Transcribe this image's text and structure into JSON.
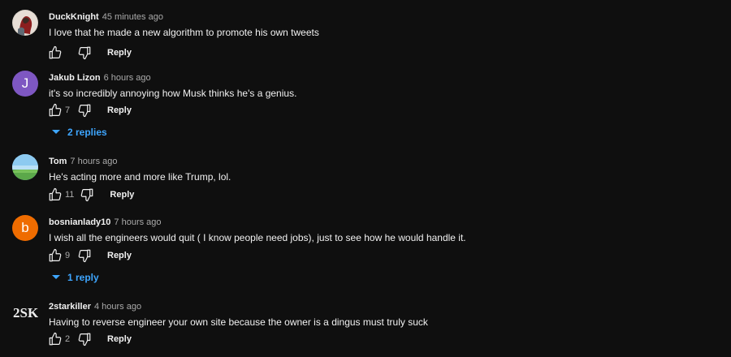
{
  "comments": [
    {
      "author": "DuckKnight",
      "time": "45 minutes ago",
      "text": "I love that he made a new algorithm to promote his own tweets",
      "likes": "",
      "reply_label": "Reply",
      "avatar": {
        "type": "image",
        "desc": "dark-red-portrait"
      }
    },
    {
      "author": "Jakub Lizon",
      "time": "6 hours ago",
      "text": "it's so incredibly annoying how Musk thinks he's a genius.",
      "likes": "7",
      "reply_label": "Reply",
      "avatar": {
        "type": "letter",
        "letter": "J",
        "color": "#7e57c2"
      },
      "replies_label": "2 replies"
    },
    {
      "author": "Tom",
      "time": "7 hours ago",
      "text": "He's acting more and more like Trump, lol.",
      "likes": "11",
      "reply_label": "Reply",
      "avatar": {
        "type": "image",
        "desc": "sky-landscape"
      }
    },
    {
      "author": "bosnianlady10",
      "time": "7 hours ago",
      "text": "I wish all the engineers would quit ( I know people need jobs), just to see how he would handle it.",
      "likes": "9",
      "reply_label": "Reply",
      "avatar": {
        "type": "letter",
        "letter": "b",
        "color": "#ef6c00"
      },
      "replies_label": "1 reply"
    },
    {
      "author": "2starkiller",
      "time": "4 hours ago",
      "text": "Having to reverse engineer your own site because the owner is a dingus must truly suck",
      "likes": "2",
      "reply_label": "Reply",
      "avatar": {
        "type": "logo",
        "logo_text": "2SK"
      }
    }
  ],
  "colors": {
    "background": "#0f0f0f",
    "text": "#f1f1f1",
    "secondary_text": "#aaaaaa",
    "link_blue": "#3ea6ff"
  }
}
